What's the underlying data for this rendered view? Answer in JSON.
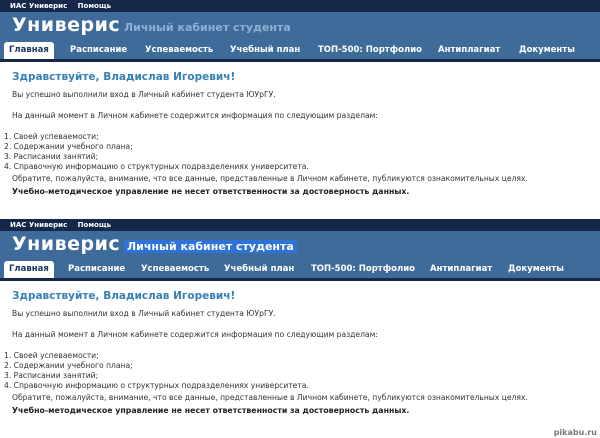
{
  "topbar": {
    "links": [
      "ИАС Универис",
      "Помощь"
    ]
  },
  "header": {
    "logo": "Универис",
    "cabinet": "Личный кабинет студента"
  },
  "tabs": [
    "Главная",
    "Расписание",
    "Успеваемость",
    "Учебный план",
    "ТОП-500: Портфолио",
    "Антиплагиат",
    "Документы"
  ],
  "content": {
    "greeting": "Здравствуйте, Владислав Игоревич!",
    "login_message": "Вы успешно выполнили вход в Личный кабинет студента ЮУрГУ.",
    "sections_intro": "На данный момент в Личном кабинете содержится информация по следующим разделам:",
    "sections": [
      "1.  Своей успеваемости;",
      "2.  Содержании учебного плана;",
      "3.  Расписании занятий;",
      "4.  Справочную информацию о структурных подразделениях университета."
    ],
    "notice": "Обратите, пожалуйста, внимание, что все данные, представленные в Личном кабинете, публикуются ознакомительных целях.",
    "disclaimer": "Учебно-методическое управление не несет ответственности за достоверность данных."
  },
  "watermark": "pikabu.ru",
  "colors": {
    "header": "#3f6b9a",
    "topbar": "#16284a",
    "greeting": "#3580b5",
    "selection": "#2f73d8"
  }
}
